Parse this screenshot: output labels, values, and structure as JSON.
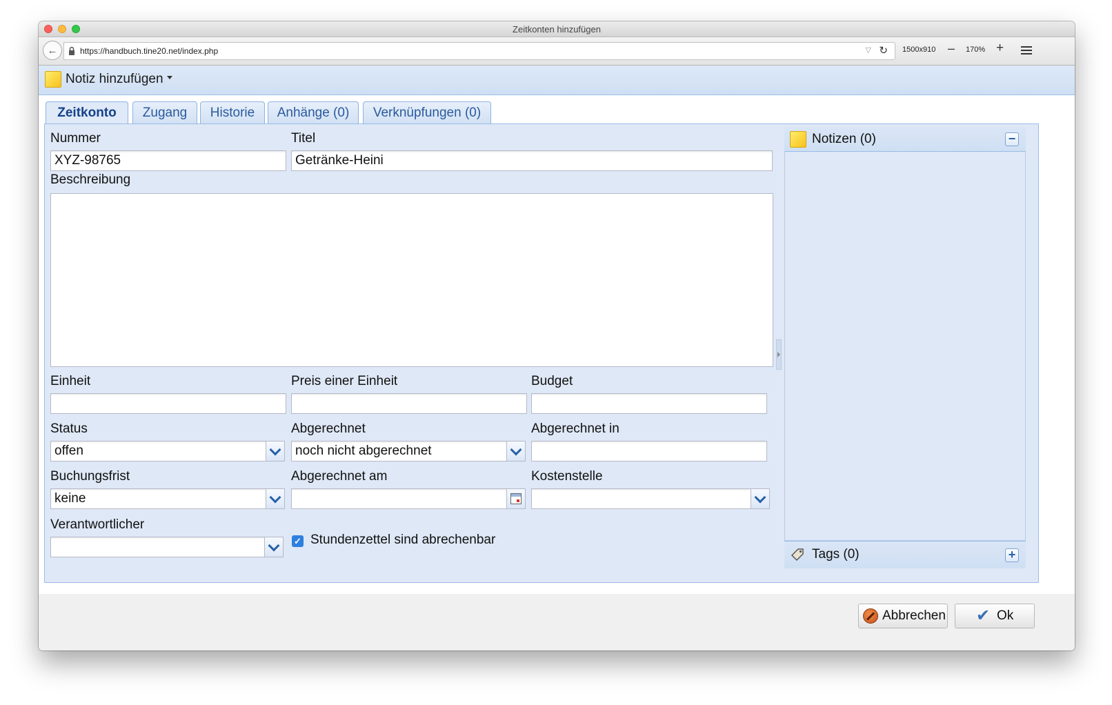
{
  "window": {
    "title": "Zeitkonten hinzufügen"
  },
  "browser": {
    "url": "https://handbuch.tine20.net/index.php",
    "viewport_size": "1500x910",
    "zoom_out_label": "–",
    "zoom_level": "170%",
    "zoom_in_label": "+"
  },
  "toolbar": {
    "add_note_label": "Notiz hinzufügen"
  },
  "tabs": [
    {
      "label": "Zeitkonto",
      "active": true
    },
    {
      "label": "Zugang",
      "active": false
    },
    {
      "label": "Historie",
      "active": false
    },
    {
      "label": "Anhänge (0)",
      "active": false
    },
    {
      "label": "Verknüpfungen (0)",
      "active": false
    }
  ],
  "form": {
    "nummer": {
      "label": "Nummer",
      "value": "XYZ-98765"
    },
    "titel": {
      "label": "Titel",
      "value": "Getränke-Heini"
    },
    "beschreibung": {
      "label": "Beschreibung",
      "value": ""
    },
    "einheit": {
      "label": "Einheit",
      "value": ""
    },
    "preis": {
      "label": "Preis einer Einheit",
      "value": ""
    },
    "budget": {
      "label": "Budget",
      "value": ""
    },
    "status": {
      "label": "Status",
      "value": "offen"
    },
    "abgerechnet": {
      "label": "Abgerechnet",
      "value": "noch nicht abgerechnet"
    },
    "abgerechnet_in": {
      "label": "Abgerechnet in",
      "value": ""
    },
    "buchungsfrist": {
      "label": "Buchungsfrist",
      "value": "keine"
    },
    "abgerechnet_am": {
      "label": "Abgerechnet am",
      "value": ""
    },
    "kostenstelle": {
      "label": "Kostenstelle",
      "value": ""
    },
    "verantwortlicher": {
      "label": "Verantwortlicher",
      "value": ""
    },
    "billable": {
      "label": "Stundenzettel sind abrechenbar",
      "checked": true
    }
  },
  "side": {
    "notes_title": "Notizen (0)",
    "collapse_label": "−",
    "tags_title": "Tags (0)",
    "add_tag_label": "+"
  },
  "footer": {
    "cancel_label": "Abbrechen",
    "ok_label": "Ok"
  },
  "colors": {
    "panel_bg": "#dfe8f6",
    "border": "#99bbe8",
    "accent": "#15428b"
  }
}
